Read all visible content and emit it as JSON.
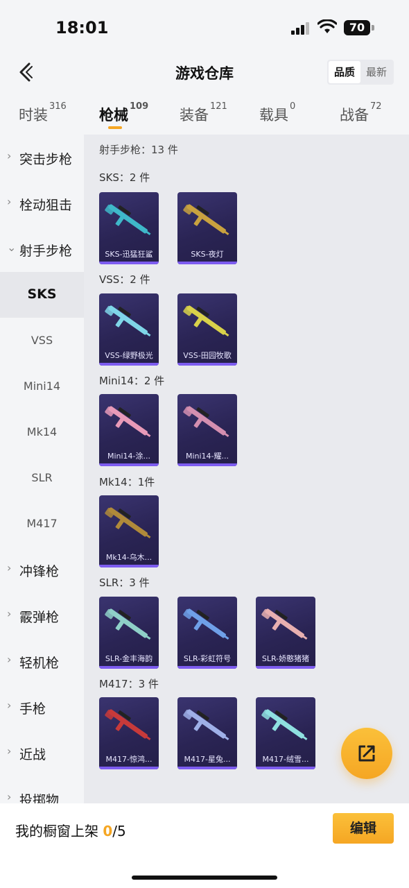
{
  "status_bar": {
    "time": "18:01",
    "battery": "70"
  },
  "header": {
    "title": "游戏仓库",
    "sort_options": [
      "品质",
      "最新"
    ],
    "active_sort": "品质"
  },
  "category_tabs": [
    {
      "label": "时装",
      "count": "316"
    },
    {
      "label": "枪械",
      "count": "109",
      "active": true
    },
    {
      "label": "装备",
      "count": "121"
    },
    {
      "label": "载具",
      "count": "0"
    },
    {
      "label": "战备",
      "count": "72"
    }
  ],
  "sidebar": {
    "items": [
      {
        "label": "突击步枪",
        "chevron": "›"
      },
      {
        "label": "栓动狙击",
        "chevron": "›"
      },
      {
        "label": "射手步枪",
        "chevron": "⌄"
      },
      {
        "label": "SKS"
      },
      {
        "label": "VSS"
      },
      {
        "label": "Mini14"
      },
      {
        "label": "Mk14"
      },
      {
        "label": "SLR"
      },
      {
        "label": "M417"
      },
      {
        "label": "冲锋枪",
        "chevron": "›"
      },
      {
        "label": "霰弹枪",
        "chevron": "›"
      },
      {
        "label": "轻机枪",
        "chevron": "›"
      },
      {
        "label": "手枪",
        "chevron": "›"
      },
      {
        "label": "近战",
        "chevron": "›"
      },
      {
        "label": "投掷物",
        "chevron": "›"
      }
    ]
  },
  "content": {
    "heading": "射手步枪：13 件",
    "groups": [
      {
        "title": "SKS：2 件",
        "items": [
          "SKS-迅猛狂鲨",
          "SKS-夜灯"
        ]
      },
      {
        "title": "VSS：2 件",
        "items": [
          "VSS-绿野极光",
          "VSS-田园牧歌"
        ]
      },
      {
        "title": "Mini14：2 件",
        "items": [
          "Mini14-涂...",
          "Mini14-耀..."
        ]
      },
      {
        "title": "Mk14：1件",
        "items": [
          "Mk14-乌木..."
        ]
      },
      {
        "title": "SLR：3 件",
        "items": [
          "SLR-金丰海韵",
          "SLR-彩虹符号",
          "SLR-娇憨猪猪"
        ]
      },
      {
        "title": "M417：3 件",
        "items": [
          "M417-惊鸿...",
          "M417-星兔...",
          "M417-绒雪..."
        ]
      }
    ]
  },
  "bottom_bar": {
    "label": "我的橱窗上架 ",
    "count": "0",
    "total": "/5",
    "edit": "编辑"
  },
  "colors": {
    "accent": "#f5a623",
    "card_bg": "#2a2454",
    "card_bar": "#7d5cf0"
  },
  "icons": {
    "back": "chevron-left-icon",
    "fab": "share-out-icon"
  }
}
